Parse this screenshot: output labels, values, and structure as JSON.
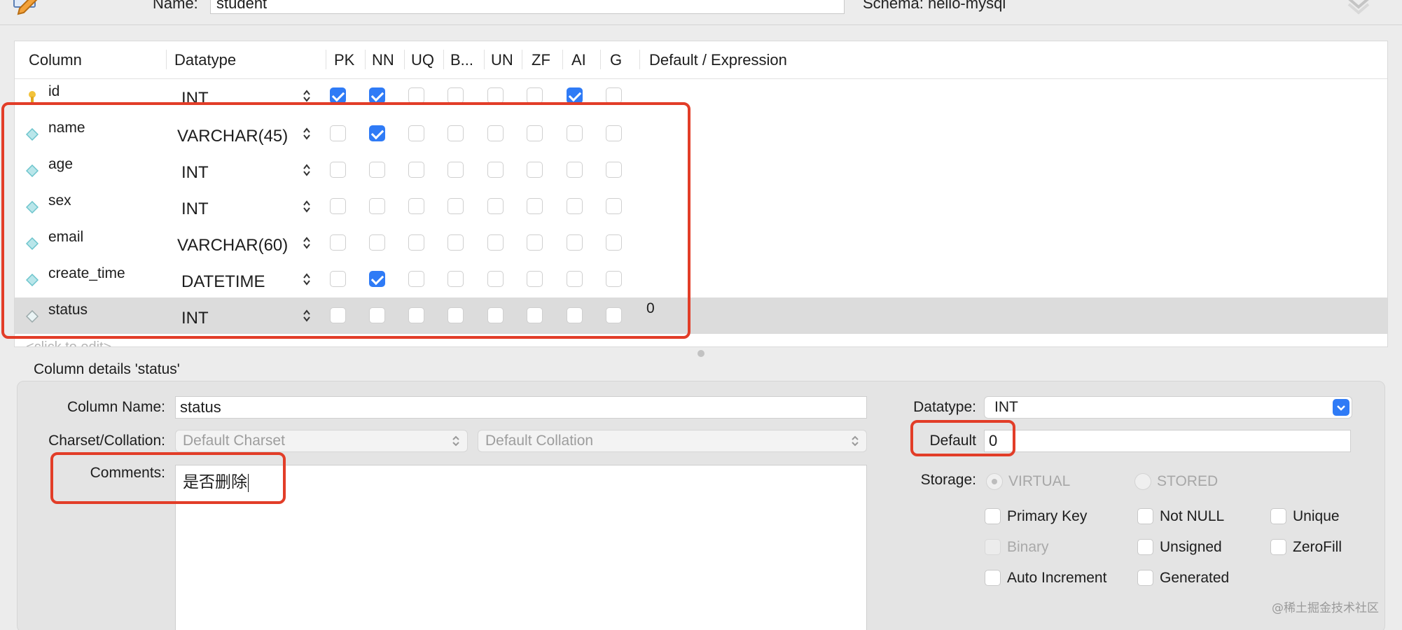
{
  "top": {
    "name_label": "Name:",
    "name_value": "student",
    "schema_label": "Schema:",
    "schema_value": "hello-mysql"
  },
  "grid": {
    "headers": [
      "Column",
      "Datatype",
      "PK",
      "NN",
      "UQ",
      "B...",
      "UN",
      "ZF",
      "AI",
      "G",
      "Default / Expression"
    ],
    "rows": [
      {
        "name": "id",
        "type": "INT",
        "icon": "primary-key-icon",
        "flags": [
          true,
          true,
          false,
          false,
          false,
          false,
          true,
          false
        ],
        "default": ""
      },
      {
        "name": "name",
        "type": "VARCHAR(45)",
        "icon": "column-icon",
        "flags": [
          false,
          true,
          false,
          false,
          false,
          false,
          false,
          false
        ],
        "default": ""
      },
      {
        "name": "age",
        "type": "INT",
        "icon": "column-icon",
        "flags": [
          false,
          false,
          false,
          false,
          false,
          false,
          false,
          false
        ],
        "default": ""
      },
      {
        "name": "sex",
        "type": "INT",
        "icon": "column-icon",
        "flags": [
          false,
          false,
          false,
          false,
          false,
          false,
          false,
          false
        ],
        "default": ""
      },
      {
        "name": "email",
        "type": "VARCHAR(60)",
        "icon": "column-icon",
        "flags": [
          false,
          false,
          false,
          false,
          false,
          false,
          false,
          false
        ],
        "default": ""
      },
      {
        "name": "create_time",
        "type": "DATETIME",
        "icon": "column-icon",
        "flags": [
          false,
          true,
          false,
          false,
          false,
          false,
          false,
          false
        ],
        "default": ""
      },
      {
        "name": "status",
        "type": "INT",
        "icon": "column-icon",
        "flags": [
          false,
          false,
          false,
          false,
          false,
          false,
          false,
          false
        ],
        "default": "0"
      }
    ],
    "click_to_edit": "<click to edit>"
  },
  "details": {
    "title": "Column details 'status'",
    "column_name_label": "Column Name:",
    "column_name_value": "status",
    "charset_label": "Charset/Collation:",
    "charset_value": "Default Charset",
    "collation_value": "Default Collation",
    "comments_label": "Comments:",
    "comments_value": "是否删除",
    "datatype_label": "Datatype:",
    "datatype_value": "INT",
    "default_label": "Default",
    "default_value": "0",
    "storage_label": "Storage:",
    "storage_virtual": "VIRTUAL",
    "storage_stored": "STORED",
    "options": {
      "primary_key": "Primary Key",
      "not_null": "Not NULL",
      "unique": "Unique",
      "binary": "Binary",
      "unsigned": "Unsigned",
      "zerofill": "ZeroFill",
      "auto_increment": "Auto Increment",
      "generated": "Generated"
    }
  },
  "watermark": "@稀土掘金技术社区",
  "colors": {
    "accent": "#2f7bf6",
    "highlight_red": "#e23d28",
    "selected_row": "#dcdcdc"
  }
}
